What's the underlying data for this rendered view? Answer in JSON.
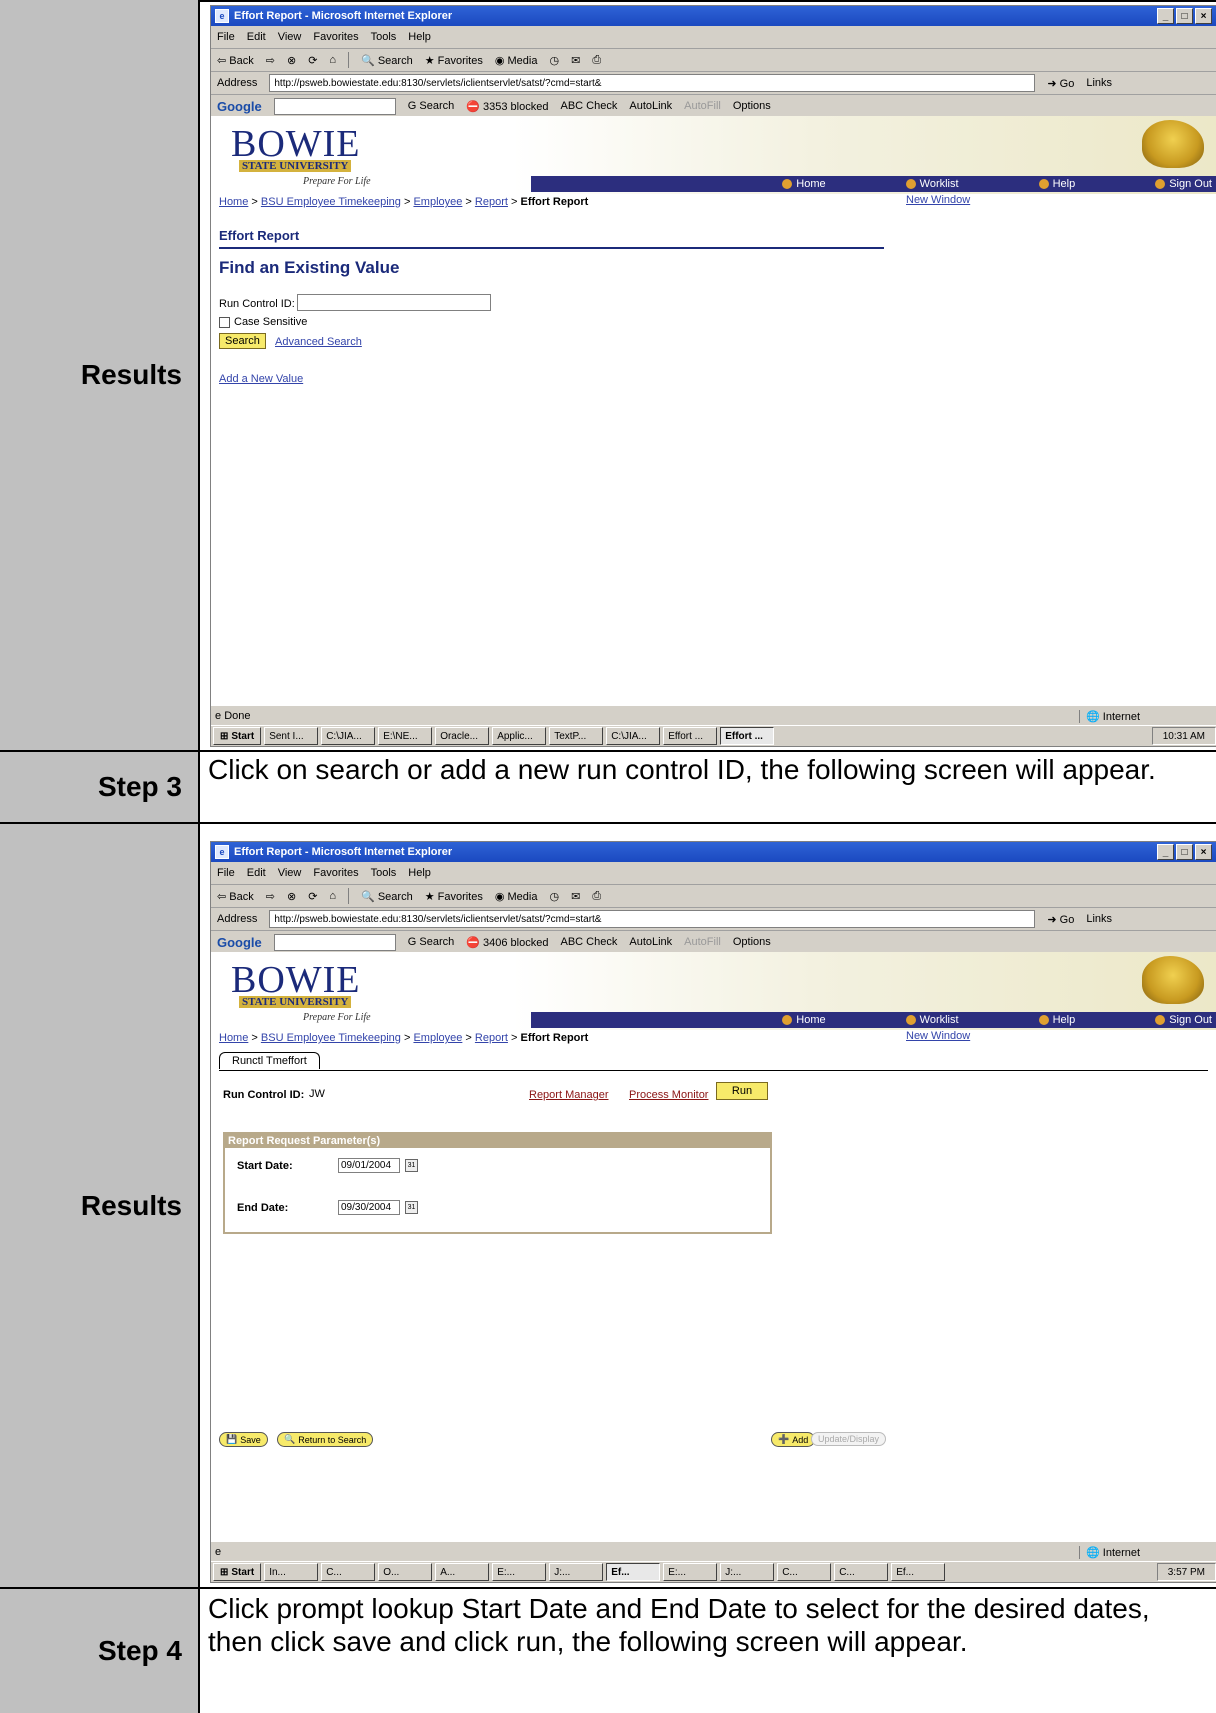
{
  "rows": {
    "results_1": "Results",
    "step3": "Step 3",
    "step3_text": "Click on search or add a new run control ID, the following screen will appear.",
    "results_2": "Results",
    "step4": "Step 4",
    "step4_text": "Click prompt lookup Start Date and End Date to select for the desired dates, then click save and click run, the following screen will appear."
  },
  "browser": {
    "title": "Effort Report - Microsoft Internet Explorer",
    "menu": [
      "File",
      "Edit",
      "View",
      "Favorites",
      "Tools",
      "Help"
    ],
    "toolbar": [
      "Back",
      "Search",
      "Favorites",
      "Media"
    ],
    "address_label": "Address",
    "url": "http://psweb.bowiestate.edu:8130/servlets/iclientservlet/satst/?cmd=start&",
    "go": "Go",
    "links": "Links",
    "google": "Google",
    "google_search": "Search",
    "google_check": "Check",
    "google_autolink": "AutoLink",
    "google_autofill": "AutoFill",
    "google_options": "Options",
    "blocked_1": "3353 blocked",
    "blocked_2": "3406 blocked",
    "status_done": "Done",
    "zone": "Internet"
  },
  "header": {
    "logo_big": "BOWIE",
    "logo_univ": "STATE UNIVERSITY",
    "motto": "Prepare For Life",
    "nav": [
      "Home",
      "Worklist",
      "Help",
      "Sign Out"
    ],
    "crumbs": [
      "Home",
      "BSU Employee Timekeeping",
      "Employee",
      "Report"
    ],
    "crumb_current": "Effort Report",
    "new_window": "New Window"
  },
  "search_page": {
    "section_title": "Effort Report",
    "find_title": "Find an Existing Value",
    "run_control_label": "Run Control ID:",
    "case_sensitive": "Case Sensitive",
    "search_button": "Search",
    "advanced_search": "Advanced Search",
    "add_new_value": "Add a New Value"
  },
  "run_page": {
    "tab": "Runctl Tmeffort",
    "run_control_label": "Run Control ID:",
    "run_control_value": "JW",
    "report_manager": "Report Manager",
    "process_monitor": "Process Monitor",
    "run_button": "Run",
    "group_title": "Report Request Parameter(s)",
    "start_label": "Start Date:",
    "start_value": "09/01/2004",
    "end_label": "End Date:",
    "end_value": "09/30/2004",
    "save": "Save",
    "return_to_search": "Return to Search",
    "add": "Add",
    "update_display": "Update/Display"
  },
  "taskbar_1": {
    "start": "Start",
    "tasks": [
      "Sent I...",
      "C:\\JIA...",
      "E:\\NE...",
      "Oracle...",
      "Applic...",
      "TextP...",
      "C:\\JIA...",
      "Effort ...",
      "Effort ..."
    ],
    "clock": "10:31 AM"
  },
  "taskbar_2": {
    "start": "Start",
    "tasks": [
      "In...",
      "C...",
      "O...",
      "A...",
      "E:...",
      "J:...",
      "Ef...",
      "E:...",
      "J:...",
      "C...",
      "C...",
      "Ef..."
    ],
    "clock": "3:57 PM"
  }
}
